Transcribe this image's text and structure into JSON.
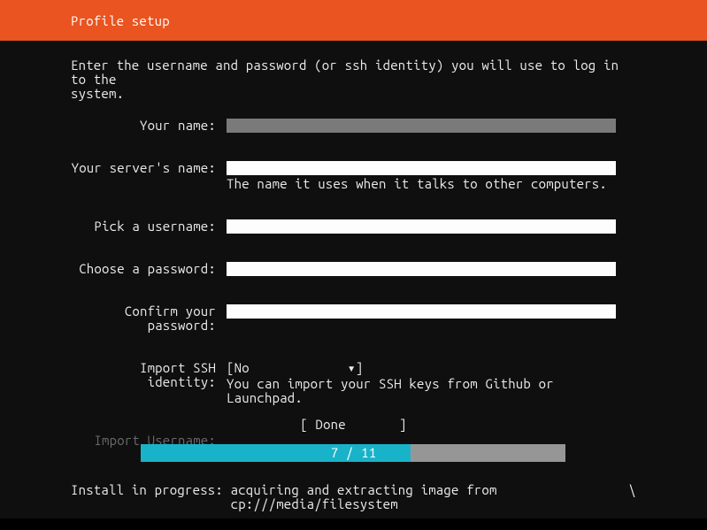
{
  "header": {
    "title": "Profile setup"
  },
  "intro": "Enter the username and password (or ssh identity) you will use to log in to the\nsystem.",
  "fields": {
    "name": {
      "label": "Your name:",
      "value": ""
    },
    "server": {
      "label": "Your server's name:",
      "value": "",
      "helper": "The name it uses when it talks to other computers."
    },
    "username": {
      "label": "Pick a username:",
      "value": ""
    },
    "password": {
      "label": "Choose a password:",
      "value": ""
    },
    "confirm": {
      "label": "Confirm your password:",
      "value": ""
    },
    "ssh": {
      "label": "Import SSH identity:",
      "selected": "No",
      "helper": "You can import your SSH keys from Github or Launchpad."
    },
    "import_user": {
      "label": "Import Username:"
    }
  },
  "brackets": {
    "open": "[ ",
    "close": " ]"
  },
  "caret": "▾",
  "done": {
    "label": "Done"
  },
  "progress": {
    "current": 7,
    "total": 11,
    "text": "7 / 11",
    "percent": 63.6
  },
  "footer": {
    "msg_line1": "Install in progress: acquiring and extracting image from",
    "msg_line2": "cp:///media/filesystem",
    "spinner": "\\"
  }
}
